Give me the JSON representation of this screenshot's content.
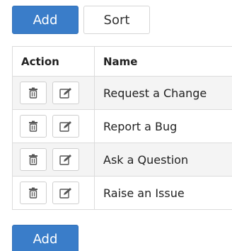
{
  "toolbar": {
    "add_label": "Add",
    "sort_label": "Sort"
  },
  "table": {
    "columns": [
      "Action",
      "Name"
    ],
    "rows": [
      {
        "name": "Request a Change",
        "actions": [
          "trash-icon",
          "edit-icon"
        ]
      },
      {
        "name": "Report a Bug",
        "actions": [
          "trash-icon",
          "edit-icon"
        ]
      },
      {
        "name": "Ask a Question",
        "actions": [
          "trash-icon",
          "edit-icon"
        ]
      },
      {
        "name": "Raise an Issue",
        "actions": [
          "trash-icon",
          "edit-icon"
        ]
      }
    ]
  },
  "footer": {
    "add_label": "Add"
  }
}
